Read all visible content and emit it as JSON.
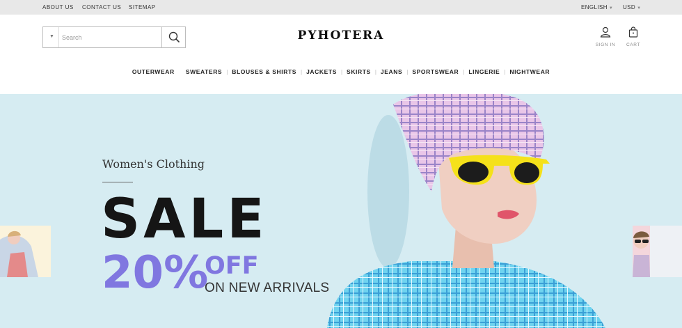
{
  "topbar": {
    "links": [
      "ABOUT US",
      "CONTACT US",
      "SITEMAP"
    ],
    "language": "ENGLISH",
    "currency": "USD"
  },
  "header": {
    "search_placeholder": "Search",
    "logo": "PYHOTERA",
    "sign_in": "SIGN IN",
    "cart": "CART"
  },
  "nav": {
    "items": [
      "OUTERWEAR",
      "SWEATERS",
      "BLOUSES & SHIRTS",
      "JACKETS",
      "SKIRTS",
      "JEANS",
      "SPORTSWEAR",
      "LINGERIE",
      "NIGHTWEAR"
    ]
  },
  "hero": {
    "subtitle": "Women's Clothing",
    "headline": "SALE",
    "percent": "20%",
    "off": "OFF",
    "tagline": "ON NEW ARRIVALS",
    "accent_color": "#8077e0",
    "background_color": "#d6ecf2"
  },
  "icons": {
    "search": "search-icon",
    "dropdown": "caret-down-icon",
    "user": "user-icon",
    "cart": "shopping-bag-icon"
  }
}
